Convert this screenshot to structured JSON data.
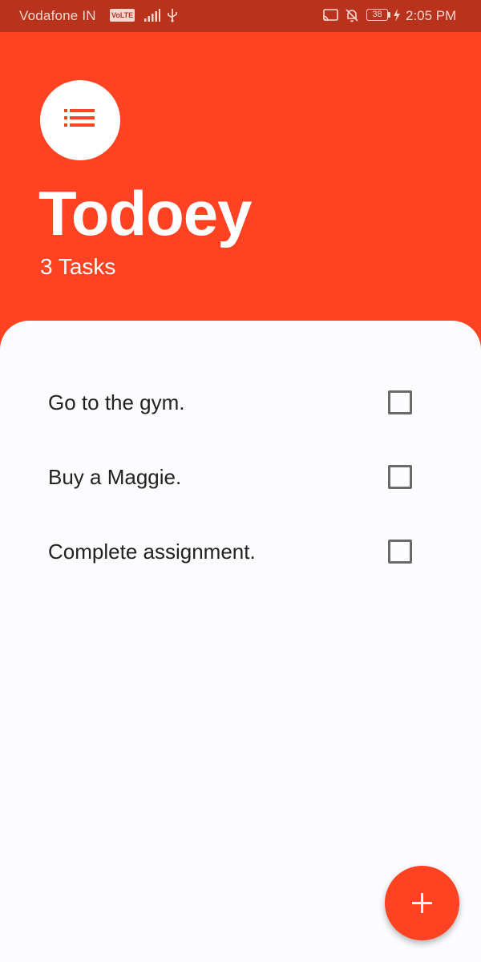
{
  "status_bar": {
    "carrier": "Vodafone IN",
    "volte": "VoLTE",
    "battery": "38",
    "time": "2:05 PM"
  },
  "header": {
    "logo_icon": "list-icon",
    "title": "Todoey",
    "task_count": "3 Tasks"
  },
  "tasks": [
    {
      "text": "Go to the gym.",
      "done": false
    },
    {
      "text": "Buy a Maggie.",
      "done": false
    },
    {
      "text": "Complete assignment.",
      "done": false
    }
  ],
  "fab": {
    "icon": "plus-icon"
  },
  "colors": {
    "accent": "#FF4222",
    "status_bar": "#B8321C",
    "sheet": "#FCFBFD",
    "text": "#222222",
    "checkbox": "#6A6A6A"
  }
}
